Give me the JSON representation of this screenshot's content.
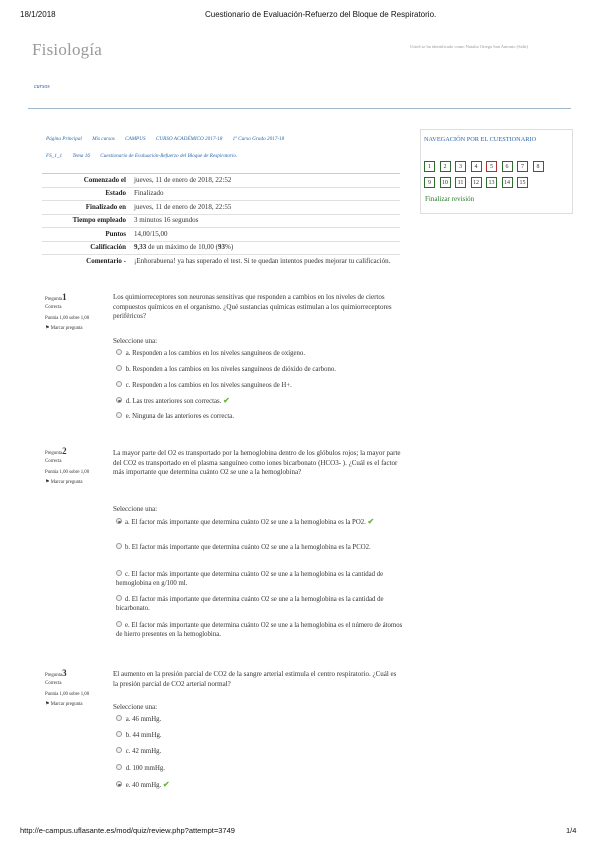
{
  "print_header": {
    "date": "18/1/2018",
    "title": "Cuestionario de Evaluación-Refuerzo del Bloque de Respiratorio."
  },
  "site": {
    "title": "Fisiología",
    "user_info": "Usted se ha identificado como Natalia Ortega San Antonio (Salir)",
    "courses_link": "cursos"
  },
  "breadcrumb": {
    "row1": [
      "Página Principal",
      "Mis cursos",
      "CAMPUS",
      "CURSO ACADÉMICO 2017-18",
      "1º Curso Grado 2017-18"
    ],
    "row2": [
      "FS_1_1",
      "Tema 16",
      "Cuestionario de Evaluación-Refuerzo del Bloque de Respiratorio."
    ]
  },
  "summary": [
    {
      "key": "Comenzado el",
      "value": "jueves, 11 de enero de 2018, 22:52"
    },
    {
      "key": "Estado",
      "value": "Finalizado"
    },
    {
      "key": "Finalizado en",
      "value": "jueves, 11 de enero de 2018, 22:55"
    },
    {
      "key": "Tiempo empleado",
      "value": "3 minutos 16 segundos"
    },
    {
      "key": "Puntos",
      "value": "14,00/15,00"
    },
    {
      "key": "Calificación",
      "value_bold": "9,33",
      "value": " de un máximo de 10,00 (",
      "value_bold2": "93",
      "value_end": "%)"
    },
    {
      "key": "Comentario -",
      "value": "¡Enhorabuena! ya has superado el test. Si te quedan intentos puedes mejorar tu calificación."
    }
  ],
  "nav": {
    "title": "NAVEGACIÓN POR EL CUESTIONARIO",
    "buttons": [
      "1",
      "2",
      "3",
      "4",
      "5",
      "6",
      "7",
      "8",
      "9",
      "10",
      "11",
      "12",
      "13",
      "14",
      "15"
    ],
    "finish_label": "Finalizar revisión"
  },
  "questions": [
    {
      "label": "Pregunta",
      "number": "1",
      "status": "Correcta",
      "points": "Puntúa 1,00 sobre 1,00",
      "flag": "Marcar pregunta",
      "text": "Los quimiorreceptores son neuronas sensitivas que responden a cambios en los niveles de ciertos compuestos químicos en el organismo. ¿Qué sustancias químicas estimulan a los quimiorreceptores periféricos?",
      "select_label": "Seleccione una:",
      "options": [
        "a. Responden a los cambios en los niveles sanguíneos de oxígeno.",
        "b. Responden a los cambios en los niveles sanguíneos de dióxido de carbono.",
        "c. Responden a los cambios en los niveles sanguíneos de H+.",
        "d. Las tres anteriores son correctas.",
        "e. Ninguna de las anteriores es correcta."
      ]
    },
    {
      "label": "Pregunta",
      "number": "2",
      "status": "Correcta",
      "points": "Puntúa 1,00 sobre 1,00",
      "flag": "Marcar pregunta",
      "text": "La mayor parte del O2 es transportado por la hemoglobina dentro de los glóbulos rojos; la mayor parte del CO2 es transportado en el plasma sanguíneo como iones bicarbonato (HCO3- ). ¿Cuál es el factor más importante que determina cuánto O2 se une a la hemoglobina?",
      "select_label": "Seleccione una:",
      "options": [
        "a. El factor más importante que determina cuánto O2 se une a la hemoglobina es la PO2.",
        "b. El factor más importante que determina cuánto O2 se une a la hemoglobina es la PCO2.",
        "c. El factor más importante que determina cuánto O2 se une a la hemoglobina es la cantidad de hemoglobina en g/100 ml.",
        "d. El factor más importante que determina cuánto O2 se une a la hemoglobina es la cantidad de bicarbonato.",
        "e. El factor más importante que determina cuánto O2 se une a la hemoglobina es el número de átomos de hierro presentes en la hemoglobina."
      ]
    },
    {
      "label": "Pregunta",
      "number": "3",
      "status": "Correcta",
      "points": "Puntúa 1,00 sobre 1,00",
      "flag": "Marcar pregunta",
      "text": "El aumento en la presión parcial de CO2 de la sangre arterial estimula el centro respiratorio. ¿Cuál es la presión parcial de CO2 arterial normal?",
      "select_label": "Seleccione una:",
      "options": [
        "a. 46 mmHg.",
        "b. 44 mmHg.",
        "c. 42 mmHg.",
        "d. 100 mmHg.",
        "e. 40 mmHg."
      ]
    }
  ],
  "footer": {
    "url": "http://e-campus.uflasante.es/mod/quiz/review.php?attempt=3749",
    "page": "1/4"
  },
  "colors": {
    "link": "#2a65a8",
    "correct": "#6ab43e"
  }
}
